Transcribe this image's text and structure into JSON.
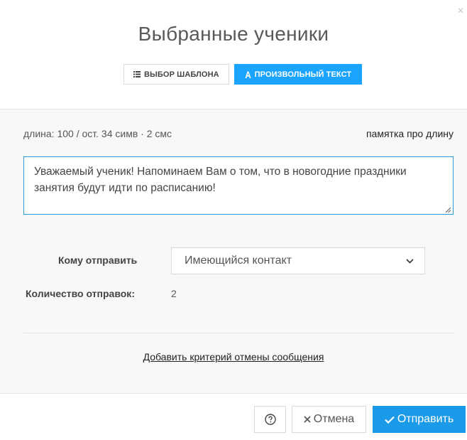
{
  "dialog": {
    "title": "Выбранные ученики",
    "close_glyph": "×"
  },
  "mode_buttons": [
    {
      "label": "ВЫБОР ШАБЛОНА",
      "icon": "list-icon",
      "active": false
    },
    {
      "label": "ПРОИЗВОЛЬНЫЙ ТЕКСТ",
      "icon": "text-a-icon",
      "active": true
    }
  ],
  "message": {
    "length_info": "длина: 100 / ост. 34 симв · 2 смс",
    "memo_link": "памятка про длину",
    "text": "Уважаемый ученик! Напоминаем Вам о том, что в новогодние праздники занятия будут идти по расписанию!"
  },
  "send_to": {
    "label": "Кому отправить",
    "selected": "Имеющийся контакт"
  },
  "send_count": {
    "label": "Количество отправок:",
    "value": "2"
  },
  "add_criterion": "Добавить критерий отмены сообщения",
  "footer": {
    "help_icon": "question-circle-icon",
    "cancel_label": "Отмена",
    "send_label": "Отправить"
  },
  "colors": {
    "accent": "#1aa3ff",
    "send_button": "#1a9ae8",
    "textarea_border": "#2e9ad6"
  }
}
